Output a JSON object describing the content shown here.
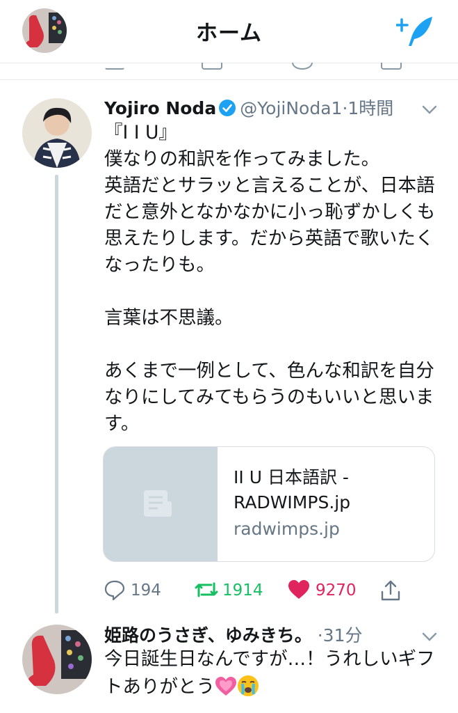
{
  "header": {
    "title": "ホーム",
    "compose_icon": "compose-tweet-icon",
    "avatar_icon": "profile-avatar"
  },
  "colors": {
    "accent": "#1da1f2",
    "retweet": "#17bf63",
    "like": "#e0245e",
    "muted": "#657786",
    "thread": "#ccd6dd"
  },
  "tweet": {
    "name": "Yojiro Noda",
    "handle": "@YojiNoda1",
    "separator": "·",
    "time": "1時間",
    "text": "『I I U』\n僕なりの和訳を作ってみました。\n英語だとサラッと言えることが、日本語だと意外となかなかに小っ恥ずかしくも思えたりします。だから英語で歌いたくなったりも。\n\n言葉は不思議。\n\nあくまで一例として、色んな和訳を自分なりにしてみてもらうのもいいと思います。",
    "card": {
      "title": "II U 日本語訳 - RADWIMPS.jp",
      "domain": "radwimps.jp"
    },
    "counts": {
      "replies": "194",
      "retweets": "1914",
      "likes": "9270"
    }
  },
  "tweet2": {
    "name": "姫路のうさぎ、ゆみきち。",
    "separator": "·",
    "time": "31分",
    "text": "今日誕生日なんですが…！うれしいギフトありがとう",
    "emojis": [
      "growing-heart-emoji",
      "crying-face-emoji"
    ]
  }
}
